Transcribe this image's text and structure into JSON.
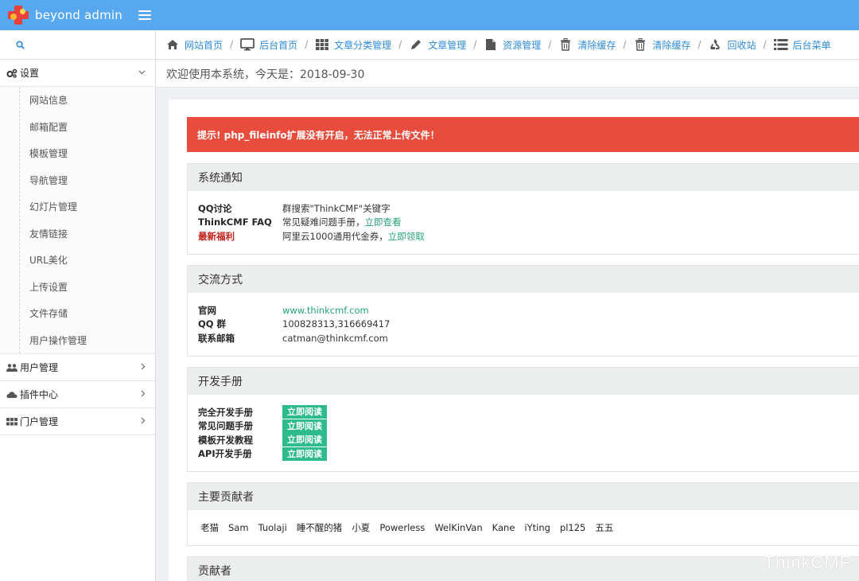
{
  "app": {
    "logo_text": "beyond admin"
  },
  "colors": {
    "navbar": "#58a8ef",
    "link": "#2e8bd9",
    "alert": "#e74c3c",
    "green": "#27a374",
    "button": "#2dbb8e"
  },
  "sidebar": {
    "search_icon": "search-icon",
    "sections": [
      {
        "label": "设置",
        "icon": "cogs-icon",
        "open": true,
        "items": [
          "网站信息",
          "邮箱配置",
          "模板管理",
          "导航管理",
          "幻灯片管理",
          "友情链接",
          "URL美化",
          "上传设置",
          "文件存储",
          "用户操作管理"
        ]
      },
      {
        "label": "用户管理",
        "icon": "users-icon",
        "open": false
      },
      {
        "label": "插件中心",
        "icon": "cloud-icon",
        "open": false
      },
      {
        "label": "门户管理",
        "icon": "grid-icon",
        "open": false
      }
    ]
  },
  "breadcrumbs": [
    {
      "label": "网站首页",
      "icon": "home-icon"
    },
    {
      "label": "后台首页",
      "icon": "desktop-icon"
    },
    {
      "label": "文章分类管理",
      "icon": "th-icon"
    },
    {
      "label": "文章管理",
      "icon": "pencil-icon"
    },
    {
      "label": "资源管理",
      "icon": "file-icon"
    },
    {
      "label": "清除缓存",
      "icon": "trash-icon"
    },
    {
      "label": "清除缓存",
      "icon": "trash-icon"
    },
    {
      "label": "回收站",
      "icon": "recycle-icon"
    },
    {
      "label": "后台菜单",
      "icon": "list-icon"
    }
  ],
  "welcome": "欢迎使用本系统，今天是：2018-09-30",
  "alert": "提示! php_fileinfo扩展没有开启，无法正常上传文件！",
  "notice": {
    "title": "系统通知",
    "rows": [
      {
        "key": "QQ讨论",
        "value": "群搜索\"ThinkCMF\"关键字",
        "link": ""
      },
      {
        "key": "ThinkCMF FAQ",
        "value": "常见疑难问题手册，",
        "link": "立即查看"
      },
      {
        "key": "最新福利",
        "value": "阿里云1000通用代金券，",
        "link": "立即领取"
      }
    ]
  },
  "contact": {
    "title": "交流方式",
    "rows": [
      {
        "key": "官网",
        "value": "www.thinkcmf.com"
      },
      {
        "key": "QQ 群",
        "value": "100828313,316669417"
      },
      {
        "key": "联系邮箱",
        "value": "catman@thinkcmf.com"
      }
    ]
  },
  "manual": {
    "title": "开发手册",
    "button_label": "立即阅读",
    "rows": [
      "完全开发手册",
      "常见问题手册",
      "模板开发教程",
      "API开发手册"
    ]
  },
  "main_contributors": {
    "title": "主要贡献者",
    "names": [
      "老猫",
      "Sam",
      "Tuolaji",
      "睡不醒的猪",
      "小夏",
      "Powerless",
      "WelKinVan",
      "Kane",
      "iYting",
      "pl125",
      "五五"
    ]
  },
  "contributors": {
    "title": "贡献者"
  },
  "watermark": "ThinkCMF"
}
